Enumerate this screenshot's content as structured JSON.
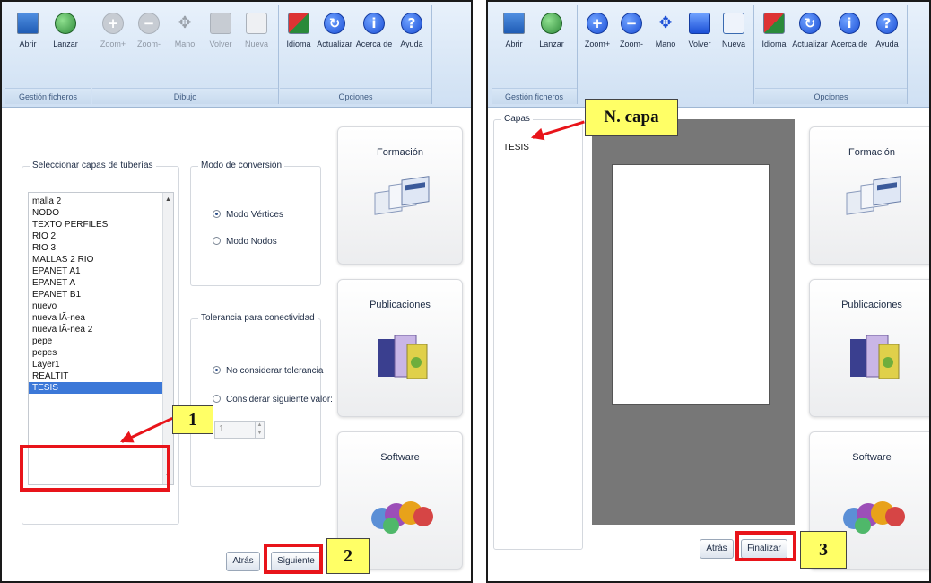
{
  "ribbon": {
    "buttons": {
      "abrir": "Abrir",
      "lanzar": "Lanzar",
      "zoom_in": "Zoom+",
      "zoom_out": "Zoom-",
      "mano": "Mano",
      "volver": "Volver",
      "nueva": "Nueva",
      "idioma": "Idioma",
      "actualizar": "Actualizar",
      "acerca_de": "Acerca de",
      "ayuda": "Ayuda"
    },
    "groups": {
      "gestion": "Gestión ficheros",
      "dibujo": "Dibujo",
      "opciones": "Opciones"
    }
  },
  "left": {
    "layers_group_title": "Seleccionar capas  de tuberías",
    "layers": [
      "malla 2",
      "NODO",
      "TEXTO PERFILES",
      "RIO 2",
      "RIO 3",
      "MALLAS 2 RIO",
      "EPANET A1",
      "EPANET A",
      "EPANET B1",
      "nuevo",
      "nueva lÃ-nea",
      "nueva lÃ-nea 2",
      "pepe",
      "pepes",
      "Layer1",
      "REALTIT",
      "TESIS"
    ],
    "selected_layer": "TESIS",
    "mode_group_title": "Modo de conversión",
    "mode_options": [
      "Modo Vértices",
      "Modo Nodos"
    ],
    "tolerance_group_title": "Tolerancia para conectividad",
    "tolerance_options": [
      "No considerar tolerancia",
      "Considerar siguiente valor:"
    ],
    "tolerance_value": "1",
    "back_button": "Atrás",
    "next_button": "Siguiente"
  },
  "right": {
    "layers_label": "Capas",
    "layer_item": "TESIS",
    "back_button": "Atrás",
    "finish_button": "Finalizar"
  },
  "cards": [
    "Formación",
    "Publicaciones",
    "Software"
  ],
  "callouts": {
    "c1": "1",
    "c2": "2",
    "c3": "3",
    "capa": "N. capa"
  },
  "colors": {
    "annotation_red": "#e8141a",
    "callout_yellow": "#ffff66",
    "selection_blue": "#3c78d8"
  }
}
